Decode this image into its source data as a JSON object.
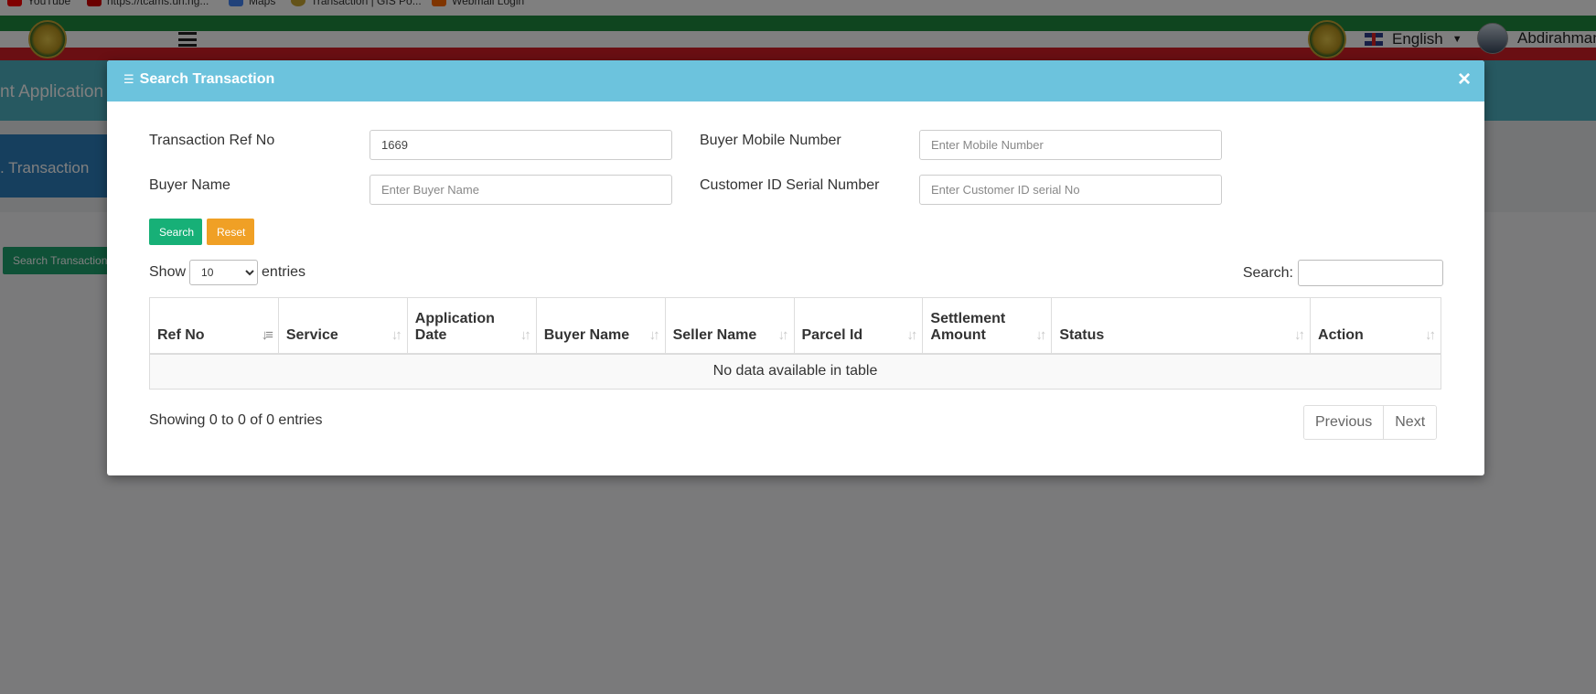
{
  "bookmarks": [
    {
      "label": "YouTube",
      "color": "#ff0000"
    },
    {
      "label": "https://tcams.un.ng...",
      "color": "#d40000"
    },
    {
      "label": "Maps",
      "color": "#4285f4"
    },
    {
      "label": "Transaction | GIS Po...",
      "color": "#c9a632"
    },
    {
      "label": "Webmail Login",
      "color": "#ff6a00"
    }
  ],
  "header": {
    "language": "English",
    "user_name": "Abdirahman"
  },
  "background": {
    "band_title": "nt Application",
    "tab_label": ". Transaction",
    "search_button": "Search Transaction"
  },
  "modal": {
    "title": "Search Transaction",
    "close_symbol": "×",
    "form": {
      "ref_label": "Transaction Ref No",
      "ref_value": "1669",
      "mobile_label": "Buyer Mobile Number",
      "mobile_placeholder": "Enter Mobile Number",
      "buyer_label": "Buyer Name",
      "buyer_placeholder": "Enter Buyer Name",
      "customer_label": "Customer ID Serial Number",
      "customer_placeholder": "Enter Customer ID serial No"
    },
    "buttons": {
      "search": "Search",
      "reset": "Reset"
    },
    "table": {
      "show_label": "Show",
      "entries_label": "entries",
      "page_size": "10",
      "search_label": "Search:",
      "columns": [
        "Ref No",
        "Service",
        "Application Date",
        "Buyer Name",
        "Seller Name",
        "Parcel Id",
        "Settlement Amount",
        "Status",
        "Action"
      ],
      "empty_message": "No data available in table",
      "info": "Showing 0 to 0 of 0 entries",
      "previous": "Previous",
      "next": "Next"
    }
  },
  "colors": {
    "modal_header": "#6cc3dd",
    "search_button": "#17b077",
    "reset_button": "#f0a025"
  }
}
